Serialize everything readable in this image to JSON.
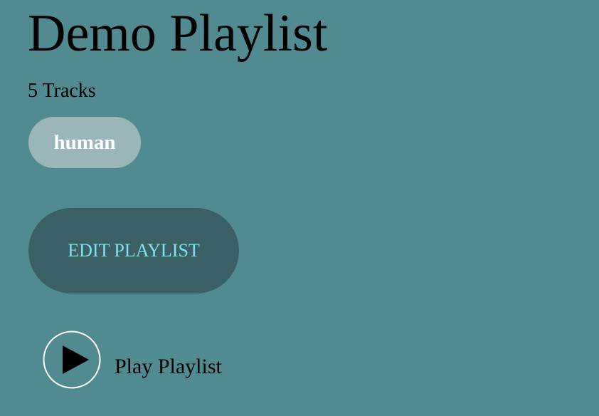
{
  "playlist": {
    "title": "Demo Playlist",
    "track_count": "5 Tracks",
    "owner": "human"
  },
  "actions": {
    "edit_label": "EDIT PLAYLIST",
    "play_label": "Play Playlist",
    "play_icon": "play-circle-icon"
  },
  "colors": {
    "background": "#528a92",
    "owner_pill": "#9bb6ba",
    "edit_button": "#3a5f64",
    "edit_text": "#7fe2ef"
  }
}
